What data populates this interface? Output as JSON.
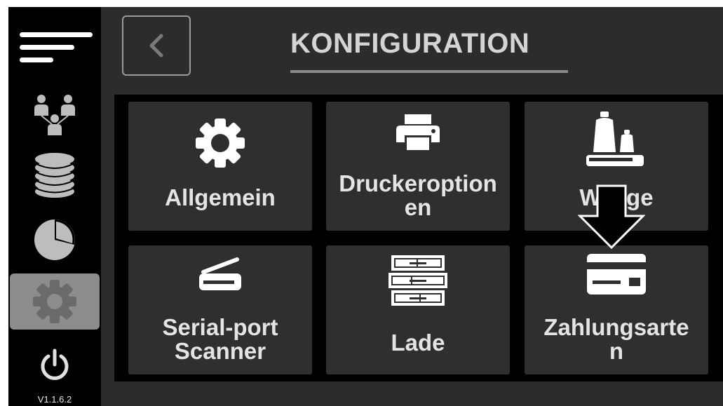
{
  "app": {
    "version": "V1.1.6.2"
  },
  "header": {
    "back_icon": "chevron-left-icon",
    "title": "KONFIGURATION"
  },
  "sidebar": {
    "items": [
      {
        "id": "menu",
        "icon": "hamburger-menu-icon"
      },
      {
        "id": "users",
        "icon": "users-hierarchy-icon"
      },
      {
        "id": "database",
        "icon": "database-stack-icon"
      },
      {
        "id": "statistics",
        "icon": "pie-chart-icon"
      },
      {
        "id": "settings",
        "icon": "gear-icon",
        "active": true
      },
      {
        "id": "power",
        "icon": "power-icon"
      }
    ]
  },
  "tiles": [
    {
      "id": "allgemein",
      "label": "Allgemein",
      "icon": "gear-icon"
    },
    {
      "id": "druckeroptionen",
      "label_line1": "Druckeroption",
      "label_line2": "en",
      "icon": "printer-icon"
    },
    {
      "id": "waage",
      "label": "Waage",
      "icon": "scale-weights-icon"
    },
    {
      "id": "scanner",
      "label_line1": "Serial-port",
      "label_line2": "Scanner",
      "icon": "scanner-icon"
    },
    {
      "id": "lade",
      "label": "Lade",
      "icon": "cash-drawer-icon"
    },
    {
      "id": "zahlungsarten",
      "label_line1": "Zahlungsarte",
      "label_line2": "n",
      "icon": "credit-card-icon"
    }
  ],
  "annotation": {
    "icon": "down-arrow-outline-icon",
    "target": "zahlungsarten"
  },
  "colors": {
    "background": "#2c2c2c",
    "sidebar": "#000000",
    "tile": "#2f2f2f",
    "text": "#e4e4e4",
    "active_item": "#8c8c8c"
  }
}
